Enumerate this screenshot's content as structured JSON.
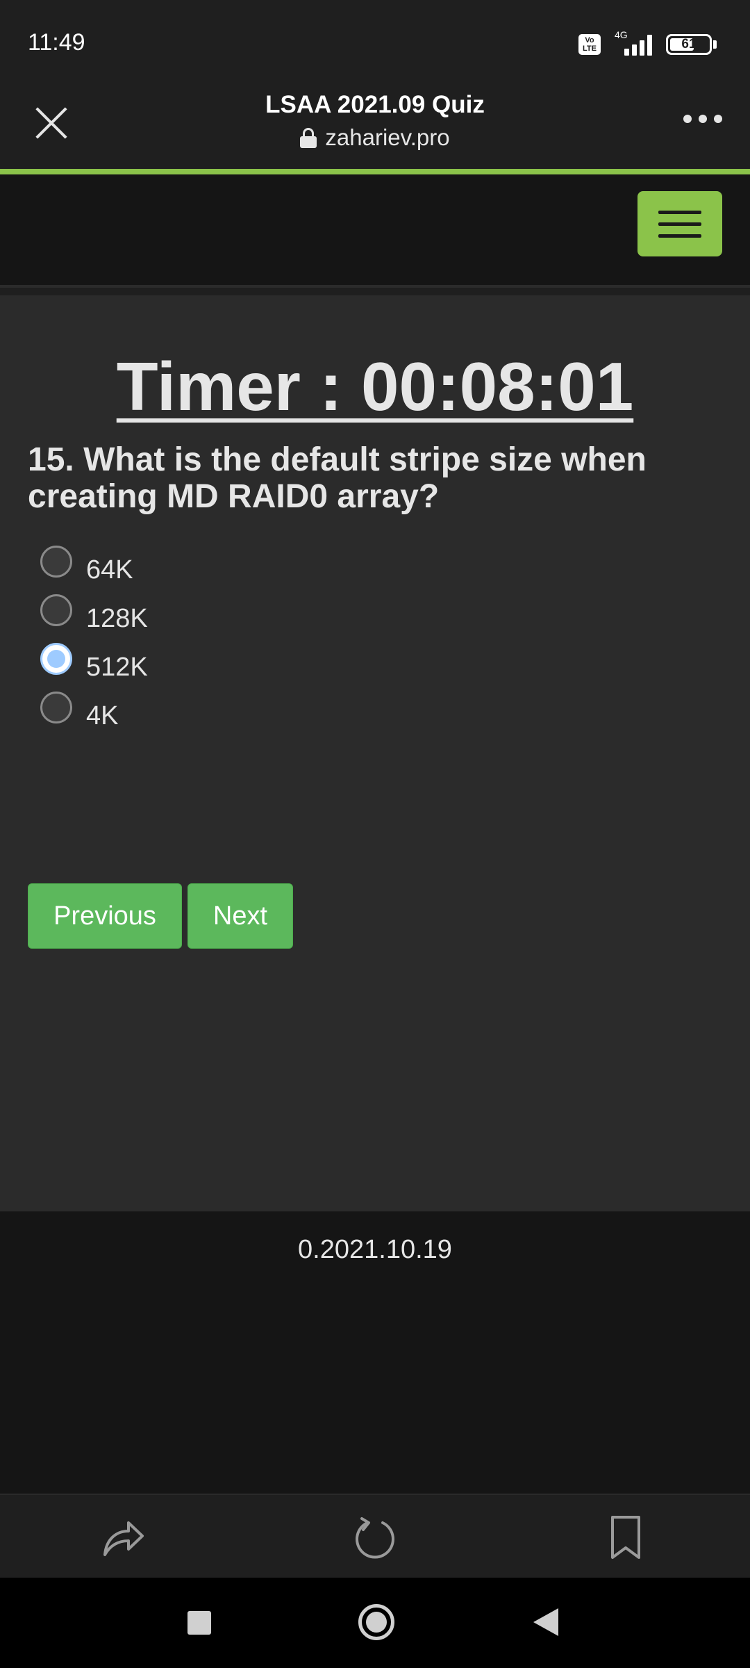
{
  "status_bar": {
    "time": "11:49",
    "network": "4G",
    "volte": "Vo LTE",
    "battery": "61"
  },
  "browser": {
    "title": "LSAA 2021.09 Quiz",
    "url": "zahariev.pro",
    "accent_color": "#8bc34a"
  },
  "quiz": {
    "timer": "Timer : 00:08:01",
    "question": "15. What is the default stripe size when creating MD RAID0 array?",
    "options": [
      {
        "label": "64K",
        "selected": false
      },
      {
        "label": "128K",
        "selected": false
      },
      {
        "label": "512K",
        "selected": true
      },
      {
        "label": "4K",
        "selected": false
      }
    ],
    "previous_label": "Previous",
    "next_label": "Next",
    "button_color": "#5cb85c"
  },
  "footer": {
    "version": "0.2021.10.19"
  },
  "icons": {
    "close": "close-icon",
    "lock": "lock-icon",
    "more": "more-icon",
    "menu": "hamburger-icon",
    "share": "share-icon",
    "reload": "reload-icon",
    "bookmark": "bookmark-icon"
  }
}
